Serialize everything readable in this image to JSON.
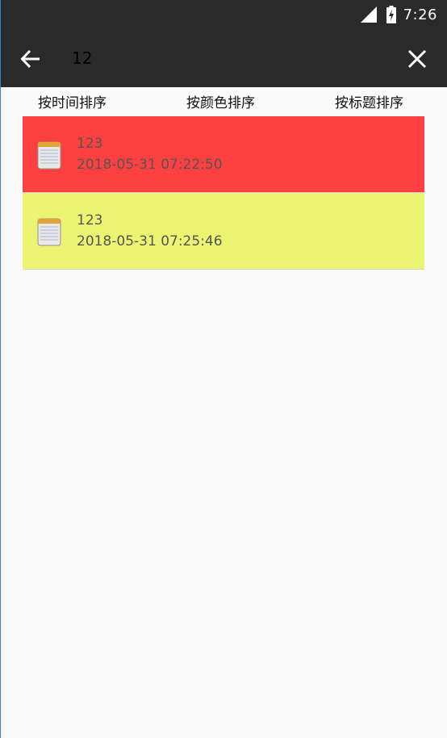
{
  "status_bar": {
    "time": "7:26",
    "icons": [
      "signal-icon",
      "battery-charging-icon"
    ]
  },
  "toolbar": {
    "back_icon": "arrow-left-icon",
    "search_value": "12",
    "clear_icon": "close-icon"
  },
  "sort_bar": {
    "by_time_label": "按时间排序",
    "by_color_label": "按颜色排序",
    "by_title_label": "按标题排序"
  },
  "notes": [
    {
      "title": "123",
      "time": "2018-05-31 07:22:50",
      "color": "#ff4040",
      "icon": "notepad-icon"
    },
    {
      "title": "123",
      "time": "2018-05-31 07:25:46",
      "color": "#ebf572",
      "icon": "notepad-icon"
    }
  ],
  "colors": {
    "app_bar": "#2a2a2a",
    "background": "#fafafa"
  }
}
